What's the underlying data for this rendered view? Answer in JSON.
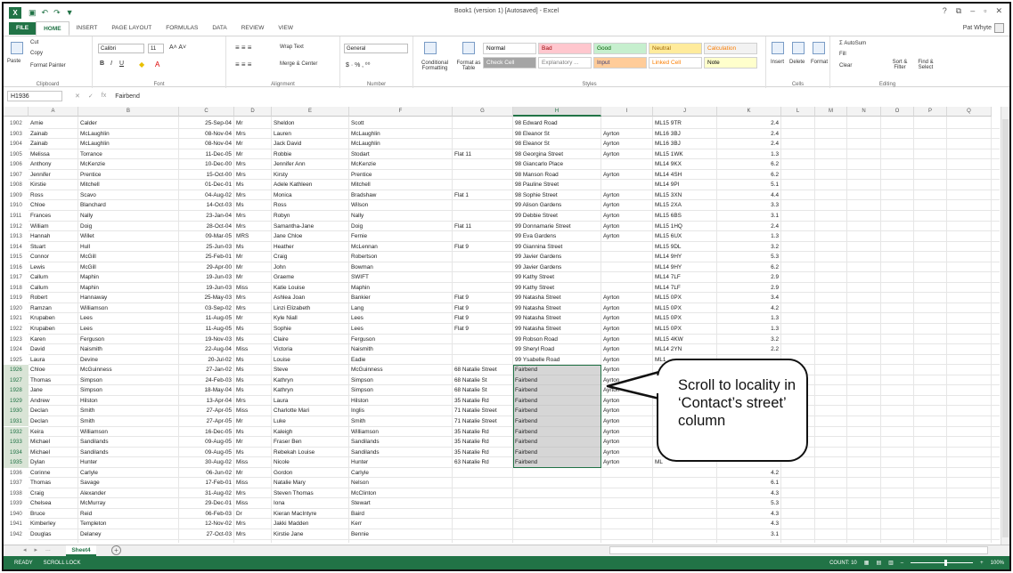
{
  "window": {
    "title": "Book1 (version 1) [Autosaved] - Excel",
    "user": "Pat Whyte",
    "controls": [
      "?",
      "⧉",
      "–",
      "▫",
      "✕"
    ]
  },
  "tabs": [
    "FILE",
    "HOME",
    "INSERT",
    "PAGE LAYOUT",
    "FORMULAS",
    "DATA",
    "REVIEW",
    "VIEW"
  ],
  "ribbon": {
    "clipboard": {
      "cut": "Cut",
      "copy": "Copy",
      "paste": "Paste",
      "painter": "Format Painter",
      "label": "Clipboard"
    },
    "font": {
      "name": "Calibri",
      "size": "11",
      "label": "Font"
    },
    "alignment": {
      "wrap": "Wrap Text",
      "merge": "Merge & Center",
      "label": "Alignment"
    },
    "number": {
      "format": "General",
      "label": "Number"
    },
    "styles": {
      "conditional": "Conditional Formatting",
      "format_table": "Format as Table",
      "items": [
        {
          "label": "Normal",
          "bg": "#ffffff",
          "fg": "#000000"
        },
        {
          "label": "Bad",
          "bg": "#ffc7ce",
          "fg": "#9c0006"
        },
        {
          "label": "Good",
          "bg": "#c6efce",
          "fg": "#006100"
        },
        {
          "label": "Neutral",
          "bg": "#ffeb9c",
          "fg": "#9c6500"
        },
        {
          "label": "Calculation",
          "bg": "#f2f2f2",
          "fg": "#fa7d00"
        },
        {
          "label": "Check Cell",
          "bg": "#a5a5a5",
          "fg": "#ffffff"
        },
        {
          "label": "Explanatory ...",
          "bg": "#ffffff",
          "fg": "#7f7f7f"
        },
        {
          "label": "Input",
          "bg": "#ffcc99",
          "fg": "#3f3f76"
        },
        {
          "label": "Linked Cell",
          "bg": "#ffffff",
          "fg": "#fa7d00"
        },
        {
          "label": "Note",
          "bg": "#ffffcc",
          "fg": "#000000"
        }
      ],
      "label": "Styles"
    },
    "cells": {
      "insert": "Insert",
      "delete": "Delete",
      "format": "Format",
      "label": "Cells"
    },
    "editing": {
      "autosum": "AutoSum",
      "fill": "Fill",
      "clear": "Clear",
      "sort": "Sort & Filter",
      "find": "Find & Select",
      "label": "Editing"
    }
  },
  "formula_bar": {
    "name_box": "H1936",
    "fx": "fx",
    "value": "Fairbend"
  },
  "columns": [
    "A",
    "B",
    "C",
    "D",
    "E",
    "F",
    "G",
    "H",
    "I",
    "J",
    "K",
    "L",
    "M",
    "N",
    "O",
    "P",
    "Q"
  ],
  "selected_column": "H",
  "rows": [
    {
      "n": "1902",
      "A": "Amie",
      "B": "Calder",
      "C": "25-Sep-04",
      "D": "Mr",
      "E": "Sheldon",
      "F": "Scott",
      "G": "",
      "H": "98 Edward Road",
      "I": "",
      "J": "ML15 9TR",
      "K": "2.4"
    },
    {
      "n": "1903",
      "A": "Zainab",
      "B": "McLaughlin",
      "C": "08-Nov-04",
      "D": "Mrs",
      "E": "Lauren",
      "F": "McLaughlin",
      "G": "",
      "H": "98 Eleanor St",
      "I": "Ayrton",
      "J": "ML16 3BJ",
      "K": "2.4"
    },
    {
      "n": "1904",
      "A": "Zainab",
      "B": "McLaughlin",
      "C": "08-Nov-04",
      "D": "Mr",
      "E": "Jack David",
      "F": "McLaughlin",
      "G": "",
      "H": "98 Eleanor St",
      "I": "Ayrton",
      "J": "ML16 3BJ",
      "K": "2.4"
    },
    {
      "n": "1905",
      "A": "Melissa",
      "B": "Torrance",
      "C": "11-Dec-05",
      "D": "Mr",
      "E": "Robbie",
      "F": "Stodart",
      "G": "Flat 11",
      "H": "98 Georgina Street",
      "I": "Ayrton",
      "J": "ML15 1WK",
      "K": "1.3"
    },
    {
      "n": "1906",
      "A": "Anthony",
      "B": "McKenzie",
      "C": "10-Dec-00",
      "D": "Mrs",
      "E": "Jennifer Ann",
      "F": "McKenzie",
      "G": "",
      "H": "98 Giancarlo Place",
      "I": "",
      "J": "ML14 9KX",
      "K": "6.2"
    },
    {
      "n": "1907",
      "A": "Jennifer",
      "B": "Prentice",
      "C": "15-Oct-00",
      "D": "Mrs",
      "E": "Kirsty",
      "F": "Prentice",
      "G": "",
      "H": "98 Manson Road",
      "I": "Ayrton",
      "J": "ML14 4SH",
      "K": "6.2"
    },
    {
      "n": "1908",
      "A": "Kirstie",
      "B": "Mitchell",
      "C": "01-Dec-01",
      "D": "Ms",
      "E": "Adele Kathleen",
      "F": "Mitchell",
      "G": "",
      "H": "98 Pauline Street",
      "I": "",
      "J": "ML14 9PI",
      "K": "5.1"
    },
    {
      "n": "1909",
      "A": "Ross",
      "B": "Scavo",
      "C": "04-Aug-02",
      "D": "Mrs",
      "E": "Monica",
      "F": "Bradshaw",
      "G": "Flat 1",
      "H": "98 Sophie Street",
      "I": "Ayrton",
      "J": "ML15 3XN",
      "K": "4.4"
    },
    {
      "n": "1910",
      "A": "Chloe",
      "B": "Blanchard",
      "C": "14-Oct-03",
      "D": "Ms",
      "E": "Ross",
      "F": "Wilson",
      "G": "",
      "H": "99 Alison Gardens",
      "I": "Ayrton",
      "J": "ML15 2XA",
      "K": "3.3"
    },
    {
      "n": "1911",
      "A": "Frances",
      "B": "Nally",
      "C": "23-Jan-04",
      "D": "Mrs",
      "E": "Robyn",
      "F": "Nally",
      "G": "",
      "H": "99 Debbie Street",
      "I": "Ayrton",
      "J": "ML15 6BS",
      "K": "3.1"
    },
    {
      "n": "1912",
      "A": "William",
      "B": "Doig",
      "C": "28-Oct-04",
      "D": "Mrs",
      "E": "Samantha-Jane",
      "F": "Doig",
      "G": "Flat 11",
      "H": "99 Donnamarie Street",
      "I": "Ayrton",
      "J": "ML15 1HQ",
      "K": "2.4"
    },
    {
      "n": "1913",
      "A": "Hannah",
      "B": "Willet",
      "C": "09-Mar-05",
      "D": "MRS",
      "E": "Jane Chloe",
      "F": "Fernie",
      "G": "",
      "H": "99 Eva Gardens",
      "I": "Ayrton",
      "J": "ML15 6UX",
      "K": "1.3"
    },
    {
      "n": "1914",
      "A": "Stuart",
      "B": "Hull",
      "C": "25-Jun-03",
      "D": "Ms",
      "E": "Heather",
      "F": "McLennan",
      "G": "Flat 9",
      "H": "99 Giannina Street",
      "I": "",
      "J": "ML15 9DL",
      "K": "3.2"
    },
    {
      "n": "1915",
      "A": "Connor",
      "B": "McGill",
      "C": "25-Feb-01",
      "D": "Mr",
      "E": "Craig",
      "F": "Robertson",
      "G": "",
      "H": "99 Javier Gardens",
      "I": "",
      "J": "ML14 9HY",
      "K": "5.3"
    },
    {
      "n": "1916",
      "A": "Lewis",
      "B": "McGill",
      "C": "29-Apr-00",
      "D": "Mr",
      "E": "John",
      "F": "Bowman",
      "G": "",
      "H": "99 Javier Gardens",
      "I": "",
      "J": "ML14 9HY",
      "K": "6.2"
    },
    {
      "n": "1917",
      "A": "Callum",
      "B": "Maphin",
      "C": "19-Jun-03",
      "D": "Mr",
      "E": "Graeme",
      "F": "SWIFT",
      "G": "",
      "H": "99 Kathy Street",
      "I": "",
      "J": "ML14 7LF",
      "K": "2.9"
    },
    {
      "n": "1918",
      "A": "Callum",
      "B": "Maphin",
      "C": "19-Jun-03",
      "D": "Miss",
      "E": "Katie Louise",
      "F": "Maphin",
      "G": "",
      "H": "99 Kathy Street",
      "I": "",
      "J": "ML14 7LF",
      "K": "2.9"
    },
    {
      "n": "1919",
      "A": "Robert",
      "B": "Hannaway",
      "C": "25-May-03",
      "D": "Mrs",
      "E": "Ashlea Joan",
      "F": "Bankier",
      "G": "Flat 9",
      "H": "99 Natasha Street",
      "I": "Ayrton",
      "J": "ML15 0PX",
      "K": "3.4"
    },
    {
      "n": "1920",
      "A": "Ramzan",
      "B": "Williamson",
      "C": "03-Sep-02",
      "D": "Mrs",
      "E": "Linzi Elizabeth",
      "F": "Lang",
      "G": "Flat 9",
      "H": "99 Natasha Street",
      "I": "Ayrton",
      "J": "ML15 0PX",
      "K": "4.2"
    },
    {
      "n": "1921",
      "A": "Krupaben",
      "B": "Lees",
      "C": "11-Aug-05",
      "D": "Mr",
      "E": "Kyle Niall",
      "F": "Lees",
      "G": "Flat 9",
      "H": "99 Natasha Street",
      "I": "Ayrton",
      "J": "ML15 0PX",
      "K": "1.3"
    },
    {
      "n": "1922",
      "A": "Krupaben",
      "B": "Lees",
      "C": "11-Aug-05",
      "D": "Ms",
      "E": "Sophie",
      "F": "Lees",
      "G": "Flat 9",
      "H": "99 Natasha Street",
      "I": "Ayrton",
      "J": "ML15 0PX",
      "K": "1.3"
    },
    {
      "n": "1923",
      "A": "Karen",
      "B": "Ferguson",
      "C": "19-Nov-03",
      "D": "Ms",
      "E": "Claire",
      "F": "Ferguson",
      "G": "",
      "H": "99 Robson Road",
      "I": "Ayrton",
      "J": "ML15 4KW",
      "K": "3.2"
    },
    {
      "n": "1924",
      "A": "David",
      "B": "Naismith",
      "C": "22-Aug-04",
      "D": "Miss",
      "E": "Victoria",
      "F": "Naismith",
      "G": "",
      "H": "99 Sheryl Road",
      "I": "Ayrton",
      "J": "ML14 2YN",
      "K": "2.2"
    },
    {
      "n": "1925",
      "A": "Laura",
      "B": "Devine",
      "C": "20-Jul-02",
      "D": "Ms",
      "E": "Louise",
      "F": "Eadie",
      "G": "",
      "H": "99 Ysabelle Road",
      "I": "Ayrton",
      "J": "ML1",
      "K": ""
    },
    {
      "n": "1926",
      "A": "Chloe",
      "B": "McGuinness",
      "C": "27-Jan-02",
      "D": "Ms",
      "E": "Steve",
      "F": "McGuinness",
      "G": "68 Natalie Street",
      "H": "Fairbend",
      "I": "Ayrton",
      "J": "",
      "K": ""
    },
    {
      "n": "1927",
      "A": "Thomas",
      "B": "Simpson",
      "C": "24-Feb-03",
      "D": "Ms",
      "E": "Kathryn",
      "F": "Simpson",
      "G": "68 Natalie St",
      "H": "Fairbend",
      "I": "Ayrton",
      "J": "",
      "K": ""
    },
    {
      "n": "1928",
      "A": "Jane",
      "B": "Simpson",
      "C": "18-May-04",
      "D": "Ms",
      "E": "Kathryn",
      "F": "Simpson",
      "G": "68 Natalie St",
      "H": "Fairbend",
      "I": "Ayrton",
      "J": "",
      "K": ""
    },
    {
      "n": "1929",
      "A": "Andrew",
      "B": "Hilston",
      "C": "13-Apr-04",
      "D": "Mrs",
      "E": "Laura",
      "F": "Hilston",
      "G": "35 Natalie Rd",
      "H": "Fairbend",
      "I": "Ayrton",
      "J": "",
      "K": ""
    },
    {
      "n": "1930",
      "A": "Declan",
      "B": "Smith",
      "C": "27-Apr-05",
      "D": "Miss",
      "E": "Charlotte Mari",
      "F": "Inglis",
      "G": "71 Natalie Street",
      "H": "Fairbend",
      "I": "Ayrton",
      "J": "",
      "K": ""
    },
    {
      "n": "1931",
      "A": "Declan",
      "B": "Smith",
      "C": "27-Apr-05",
      "D": "Mr",
      "E": "Luke",
      "F": "Smith",
      "G": "71 Natalie Street",
      "H": "Fairbend",
      "I": "Ayrton",
      "J": "",
      "K": ""
    },
    {
      "n": "1932",
      "A": "Keira",
      "B": "Williamson",
      "C": "16-Dec-05",
      "D": "Ms",
      "E": "Kaleigh",
      "F": "Williamson",
      "G": "35 Natalie Rd",
      "H": "Fairbend",
      "I": "Ayrton",
      "J": "",
      "K": ""
    },
    {
      "n": "1933",
      "A": "Michael",
      "B": "Sandilands",
      "C": "09-Aug-05",
      "D": "Mr",
      "E": "Fraser Ben",
      "F": "Sandilands",
      "G": "35 Natalie Rd",
      "H": "Fairbend",
      "I": "Ayrton",
      "J": "",
      "K": ""
    },
    {
      "n": "1934",
      "A": "Michael",
      "B": "Sandilands",
      "C": "09-Aug-05",
      "D": "Ms",
      "E": "Rebekah Louise",
      "F": "Sandilands",
      "G": "35 Natalie Rd",
      "H": "Fairbend",
      "I": "Ayrton",
      "J": "",
      "K": ""
    },
    {
      "n": "1935",
      "A": "Dylan",
      "B": "Hunter",
      "C": "30-Aug-02",
      "D": "Miss",
      "E": "Nicole",
      "F": "Hunter",
      "G": "63 Natalie Rd",
      "H": "Fairbend",
      "I": "Ayrton",
      "J": "ML",
      "K": ""
    },
    {
      "n": "1936",
      "A": "Corinne",
      "B": "Carlyle",
      "C": "06-Jun-02",
      "D": "Mr",
      "E": "Gordon",
      "F": "Carlyle",
      "G": "",
      "H": "",
      "I": "",
      "J": "",
      "K": "4.2"
    },
    {
      "n": "1937",
      "A": "Thomas",
      "B": "Savage",
      "C": "17-Feb-01",
      "D": "Miss",
      "E": "Natalie Mary",
      "F": "Nelson",
      "G": "",
      "H": "",
      "I": "",
      "J": "",
      "K": "6.1"
    },
    {
      "n": "1938",
      "A": "Craig",
      "B": "Alexander",
      "C": "31-Aug-02",
      "D": "Mrs",
      "E": "Steven Thomas",
      "F": "McClinton",
      "G": "",
      "H": "",
      "I": "",
      "J": "",
      "K": "4.3"
    },
    {
      "n": "1939",
      "A": "Chelsea",
      "B": "McMurray",
      "C": "29-Dec-01",
      "D": "Miss",
      "E": "Iona",
      "F": "Stewart",
      "G": "",
      "H": "",
      "I": "",
      "J": "",
      "K": "5.3"
    },
    {
      "n": "1940",
      "A": "Bruce",
      "B": "Reid",
      "C": "06-Feb-03",
      "D": "Dr",
      "E": "Kieran MacIntyre",
      "F": "Baird",
      "G": "",
      "H": "",
      "I": "",
      "J": "",
      "K": "4.3"
    },
    {
      "n": "1941",
      "A": "Kimberley",
      "B": "Templeton",
      "C": "12-Nov-02",
      "D": "Mrs",
      "E": "Jakki Madden",
      "F": "Kerr",
      "G": "",
      "H": "",
      "I": "",
      "J": "",
      "K": "4.3"
    },
    {
      "n": "1942",
      "A": "Douglas",
      "B": "Delaney",
      "C": "27-Oct-03",
      "D": "Mrs",
      "E": "Kirstie Jane",
      "F": "Bennie",
      "G": "",
      "H": "",
      "I": "",
      "J": "",
      "K": "3.1"
    }
  ],
  "selected_rows": [
    "1926",
    "1927",
    "1928",
    "1929",
    "1930",
    "1931",
    "1932",
    "1933",
    "1934",
    "1935"
  ],
  "sheet": {
    "name": "Sheet4",
    "nav": [
      "◂",
      "▸",
      "..."
    ]
  },
  "status": {
    "ready": "READY",
    "scroll_lock": "SCROLL LOCK",
    "count": "COUNT: 10",
    "zoom": "100%"
  },
  "callout": {
    "text": "Scroll to locality in ‘Contact’s street’ column"
  },
  "colors": {
    "excel_green": "#217346",
    "selection_grey": "#b4b4b4"
  }
}
